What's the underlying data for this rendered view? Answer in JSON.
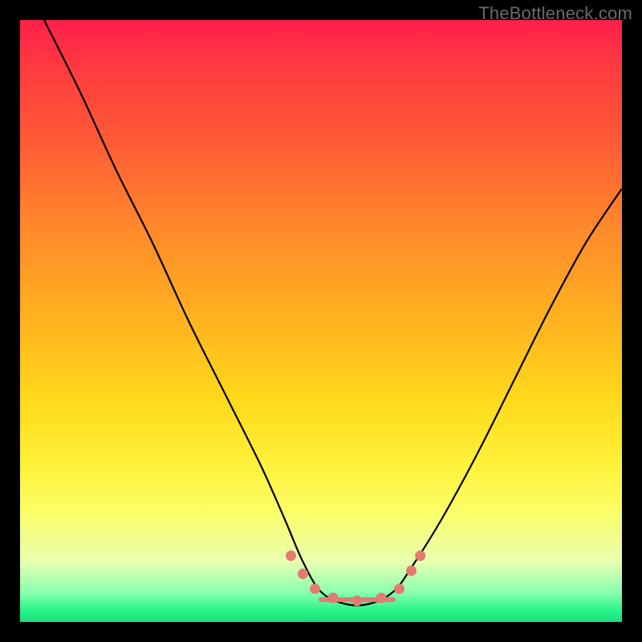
{
  "watermark": "TheBottleneck.com",
  "colors": {
    "frame": "#000000",
    "curve": "#000000",
    "valley_marker": "#e47a72",
    "gradient_top": "#ff1f4b",
    "gradient_bottom": "#17e07e"
  },
  "chart_data": {
    "type": "line",
    "title": "",
    "xlabel": "",
    "ylabel": "",
    "xlim": [
      0,
      100
    ],
    "ylim": [
      0,
      100
    ],
    "grid": false,
    "legend": false,
    "note": "No numeric axes or tick labels are visible; values are estimated from pixel position on a 0–100 normalized scale. Higher y = higher on image. The curve is a U/V shape with its floor around x≈50–62, and salmon markers sit at the valley.",
    "series": [
      {
        "name": "curve",
        "x": [
          4,
          10,
          16,
          22,
          28,
          34,
          40,
          44,
          47,
          50,
          54,
          58,
          62,
          65,
          70,
          76,
          82,
          88,
          94,
          100
        ],
        "y": [
          100,
          88,
          75,
          63,
          50,
          38,
          26,
          17,
          10,
          5,
          3,
          3,
          5,
          9,
          17,
          28,
          40,
          52,
          63,
          72
        ]
      }
    ],
    "valley_markers": {
      "name": "valley-dots",
      "x": [
        45,
        47,
        49,
        52,
        56,
        60,
        63,
        65,
        66.5
      ],
      "y": [
        11,
        8,
        5.5,
        4,
        3.5,
        4,
        5.5,
        8.5,
        11
      ]
    }
  }
}
